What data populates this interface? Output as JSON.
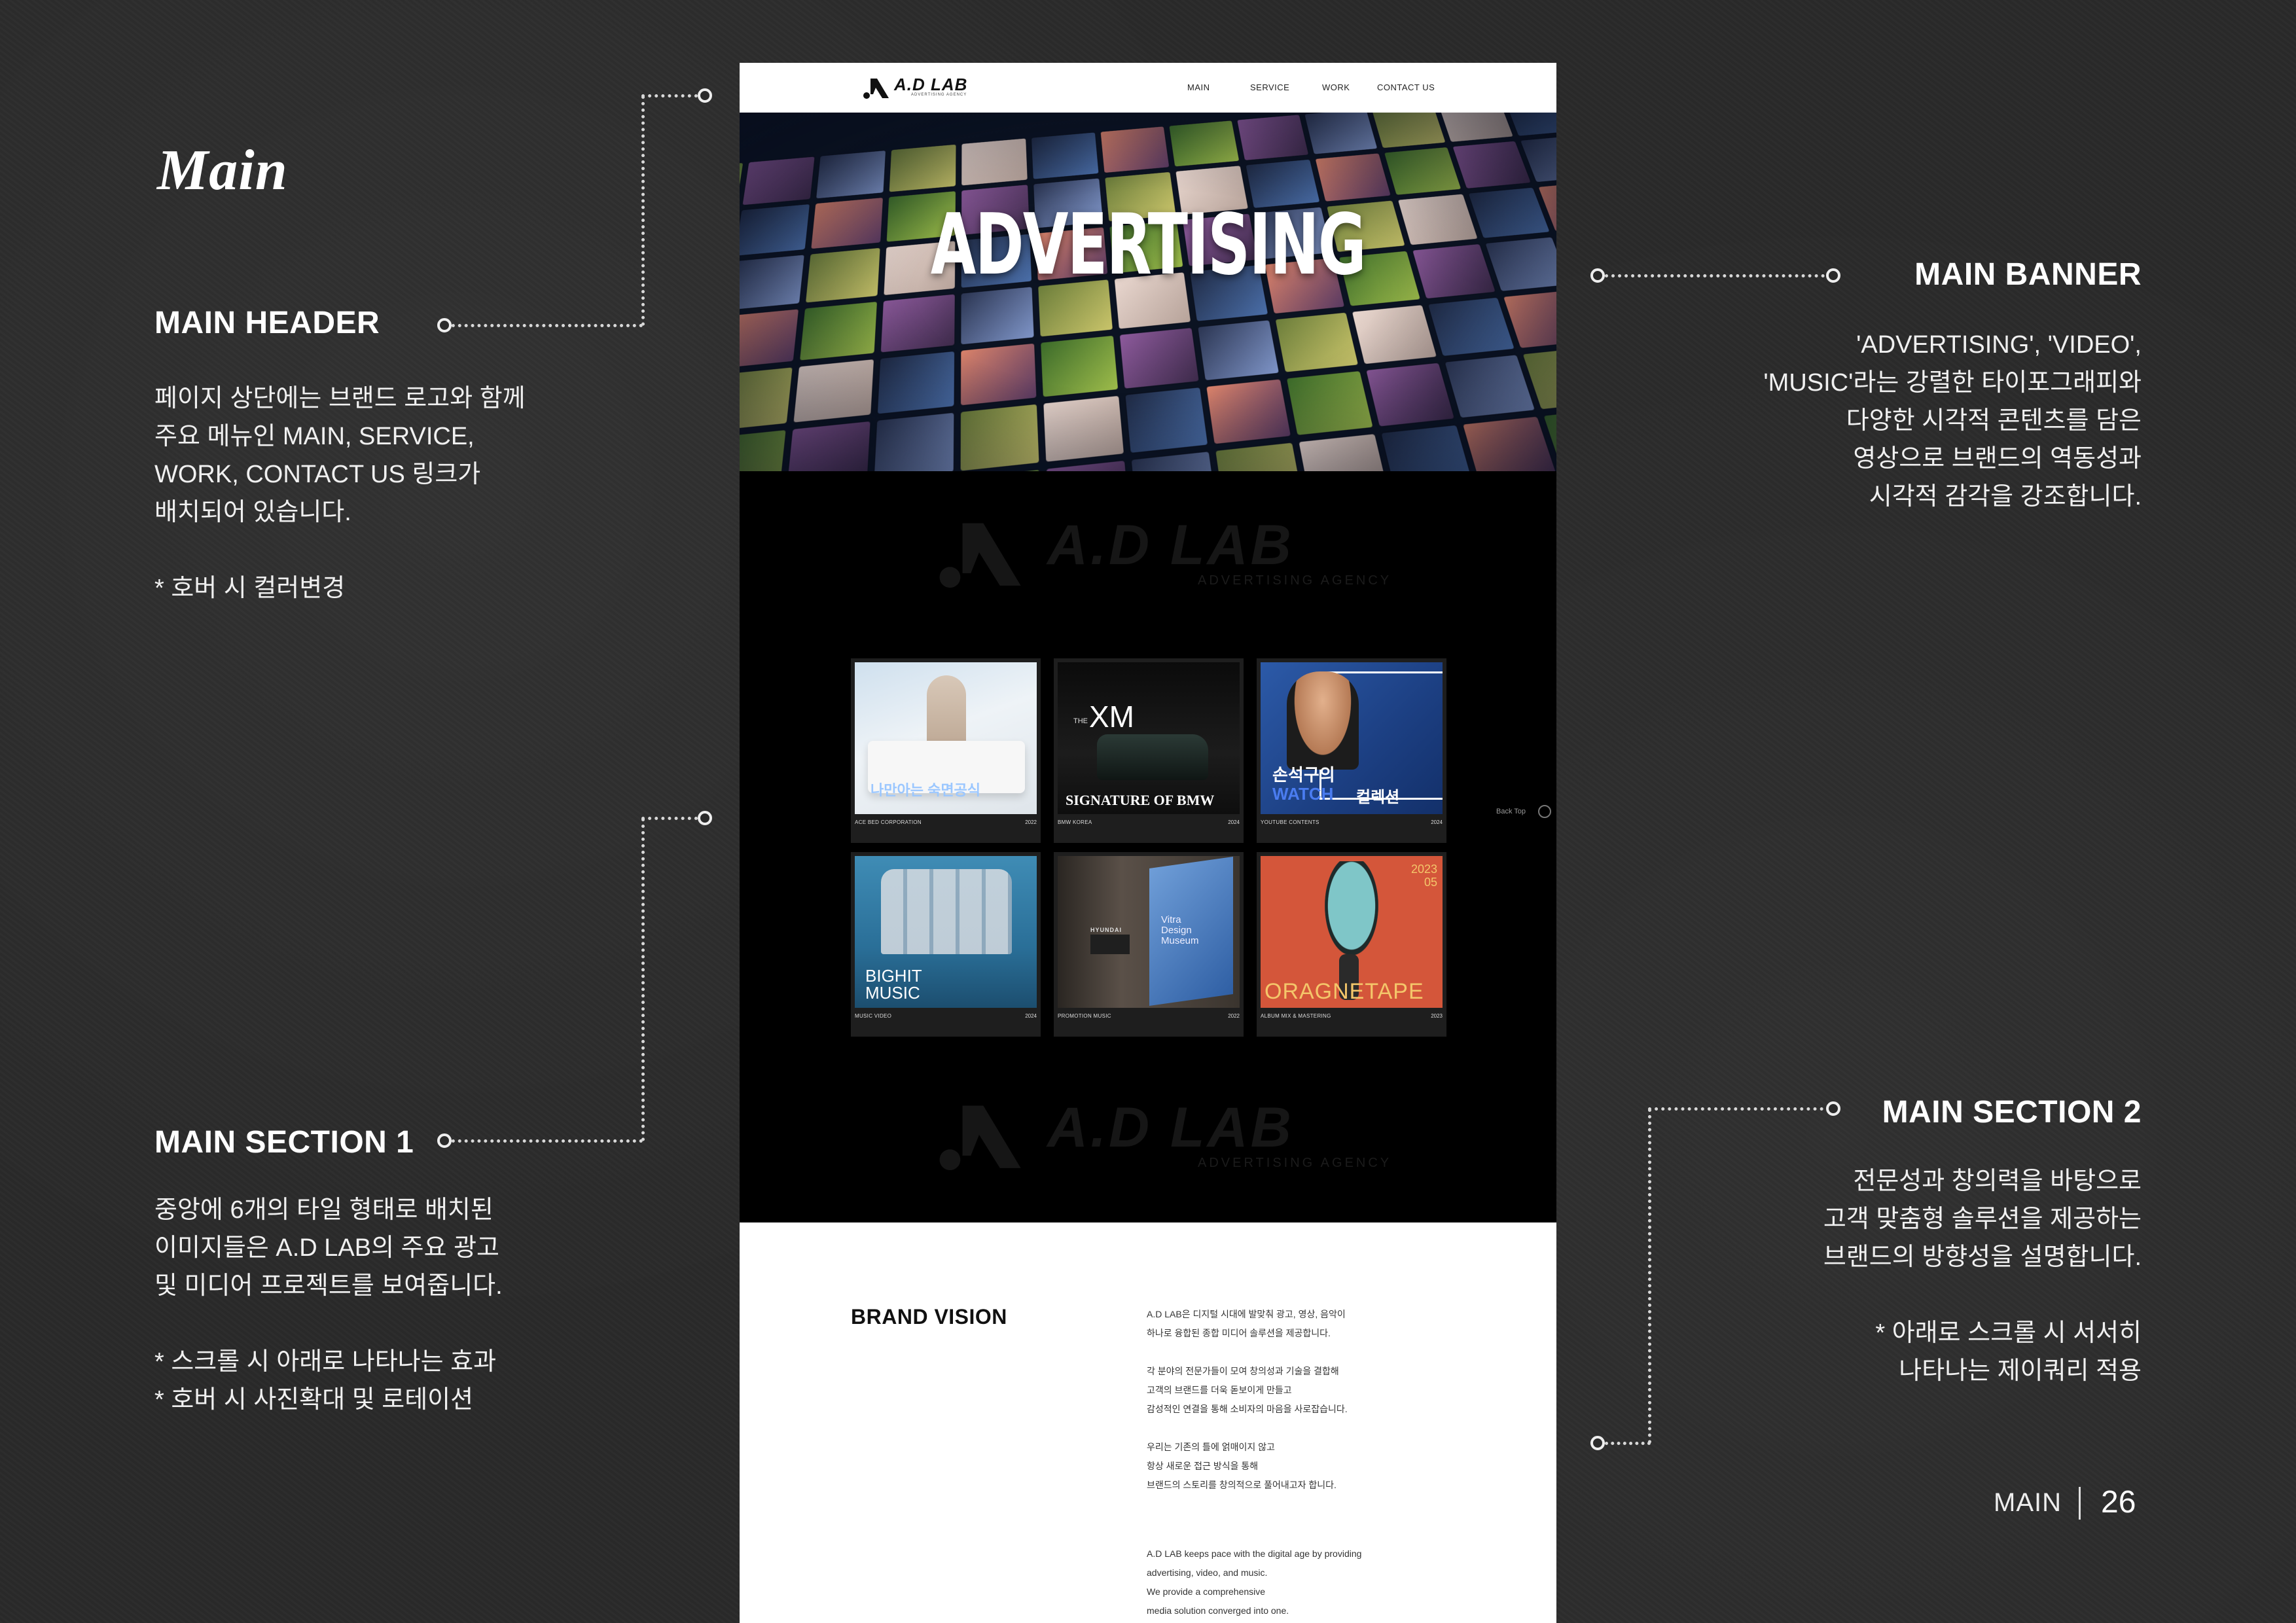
{
  "slide": {
    "title": "Main",
    "footer_label": "MAIN",
    "page_number": "26"
  },
  "annotations": {
    "main_header": {
      "heading": "MAIN HEADER",
      "body": "페이지 상단에는 브랜드 로고와 함께\n주요 메뉴인 MAIN, SERVICE,\nWORK, CONTACT US 링크가\n배치되어 있습니다.\n\n* 호버 시 컬러변경"
    },
    "main_section_1": {
      "heading": "MAIN SECTION 1",
      "body": "중앙에 6개의 타일 형태로 배치된\n이미지들은 A.D LAB의 주요 광고\n및 미디어 프로젝트를 보여줍니다.\n\n* 스크롤 시 아래로 나타나는 효과\n* 호버 시 사진확대 및 로테이션"
    },
    "main_banner": {
      "heading": "MAIN BANNER",
      "body": "'ADVERTISING', 'VIDEO',\n'MUSIC'라는 강렬한 타이포그래피와\n다양한 시각적 콘텐츠를 담은\n영상으로 브랜드의 역동성과\n시각적 감각을 강조합니다."
    },
    "main_section_2": {
      "heading": "MAIN SECTION 2",
      "body": "전문성과 창의력을 바탕으로\n고객 맞춤형 솔루션을 제공하는\n브랜드의 방향성을 설명합니다.\n\n* 아래로  스크롤 시 서서히\n나타나는 제이쿼리 적용"
    }
  },
  "mockup": {
    "logo": {
      "text": "A.D LAB",
      "sub": "ADVERTISING AGENCY"
    },
    "nav": [
      "MAIN",
      "SERVICE",
      "WORK",
      "CONTACT US"
    ],
    "banner_word": "ADVERTISING",
    "watermark": {
      "text": "A.D LAB",
      "sub": "ADVERTISING AGENCY"
    },
    "back_top": "Back Top",
    "cards": [
      {
        "overlay": "나만아는 숙면공식",
        "caption": "ACE BED CORPORATION",
        "year": "2022"
      },
      {
        "overlay_top": "XM",
        "overlay_the": "THE",
        "overlay": "SIGNATURE OF BMW",
        "caption": "BMW KOREA",
        "year": "2024"
      },
      {
        "overlay_line1": "손석구의",
        "overlay_watch": "WATCH",
        "overlay_line2": "컬렉션",
        "caption": "YOUTUBE CONTENTS",
        "year": "2024"
      },
      {
        "overlay": "BIGHIT\nMUSIC",
        "caption": "MUSIC VIDEO",
        "year": "2024"
      },
      {
        "overlay": "Vitra\nDesign\nMuseum",
        "overlay_brand": "HYUNDAI",
        "caption": "PROMOTION MUSIC",
        "year": "2022"
      },
      {
        "overlay": "ORAGNETAPE",
        "overlay_date": "2023\n05",
        "caption": "ALBUM MIX & MASTERING",
        "year": "2023"
      }
    ],
    "brand_vision": {
      "title": "BRAND VISION",
      "body": "A.D LAB은 디지털 시대에 발맞춰 광고, 영상, 음악이\n하나로 융합된 종합 미디어 솔루션을 제공합니다.\n\n각 분야의 전문가들이 모여 창의성과 기술을 결합해\n고객의 브랜드를 더욱 돋보이게 만들고\n감성적인 연결을 통해 소비자의 마음을 사로잡습니다.\n\n우리는 기존의 틀에 얽매이지 않고\n항상 새로운 접근 방식을 통해\n브랜드의 스토리를 창의적으로 풀어내고자 합니다.",
      "english": "A.D LAB keeps pace with the digital age by providing\nadvertising, video, and music.\nWe provide a comprehensive\nmedia solution converged into one."
    }
  },
  "colors": {
    "background": "#2a2a2a",
    "accent_blue": "#4a7cf0",
    "card_bg": "#1e1e1e"
  }
}
